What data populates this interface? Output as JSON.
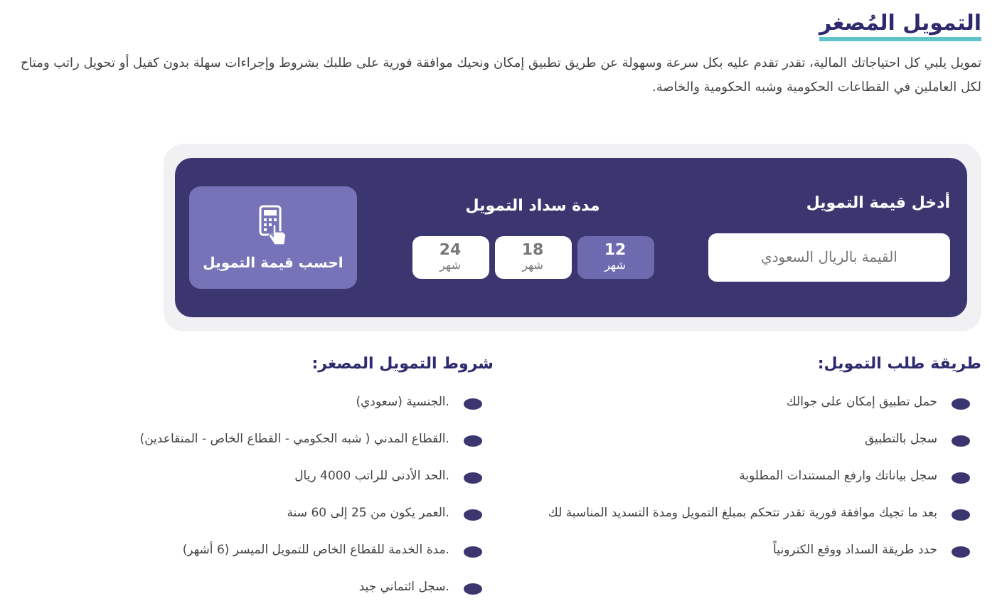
{
  "title": "التمويل المُصغر",
  "intro": "تمويل يلبي كل احتياجاتك المالية، تقدر تقدم عليه بكل سرعة وسهولة عن طريق تطبيق إمكان ونحيك موافقة فورية على طلبك بشروط وإجراءات سهلة بدون كفيل أو تحويل راتب ومتاح لكل العاملين في القطاعات الحكومية وشبه الحكومية والخاصة.",
  "calculator": {
    "amount_label": "أدخل قيمة التمويل",
    "amount_placeholder": "القيمة بالريال السعودي",
    "duration_label": "مدة سداد التمويل",
    "durations": [
      {
        "value": "12",
        "unit": "شهر",
        "selected": true
      },
      {
        "value": "18",
        "unit": "شهر",
        "selected": false
      },
      {
        "value": "24",
        "unit": "شهر",
        "selected": false
      }
    ],
    "button_label": "احسب قيمة التمويل"
  },
  "steps": {
    "title": "طريقة طلب التمويل:",
    "items": [
      "حمل تطبيق إمكان على جوالك",
      "سجل بالتطبيق",
      "سجل بياناتك وارفع المستندات المطلوبة",
      "بعد ما تجيك موافقة فورية تقدر تتحكم بمبلغ التمويل ومدة التسديد المناسبة لك",
      "حدد طريقة السداد ووقع الكترونياً"
    ]
  },
  "conditions": {
    "title": "شروط التمويل المصغر:",
    "items": [
      ".الجنسية (سعودي)",
      ".القطاع المدني ( شبه الحكومي - القطاع الخاص - المتقاعدين)",
      ".الحد الأدنى للراتب 4000 ريال",
      ".العمر يكون من 25 إلى 60 سنة",
      ".مدة الخدمة للقطاع الخاص للتمويل الميسر (6 أشهر)",
      ".سجل ائتماني جيد"
    ]
  }
}
